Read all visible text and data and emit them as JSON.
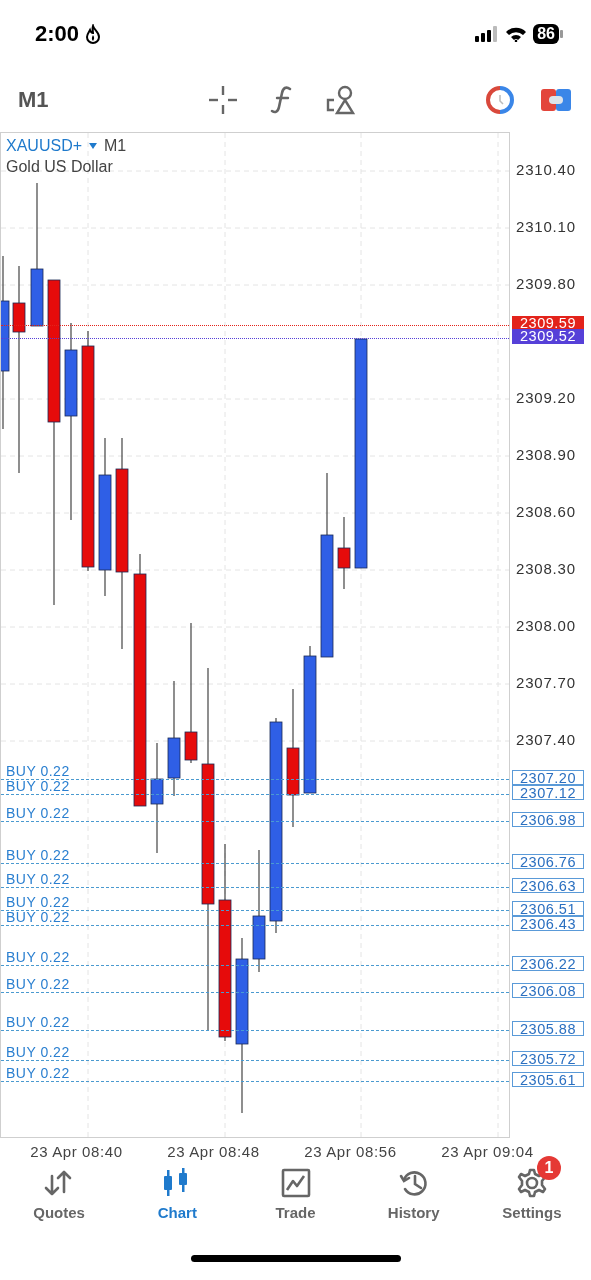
{
  "status_bar": {
    "time": "2:00",
    "battery": "86"
  },
  "toolbar": {
    "timeframe": "M1"
  },
  "chart": {
    "symbol": "XAUUSD+",
    "timeframe": "M1",
    "description": "Gold US Dollar",
    "y_ticks": [
      "2310.40",
      "2310.10",
      "2309.80",
      "2309.20",
      "2308.90",
      "2308.60",
      "2308.30",
      "2308.00",
      "2307.70",
      "2307.40"
    ],
    "price_lines": [
      {
        "price": "2309.59",
        "color": "#e3231b"
      },
      {
        "price": "2309.52",
        "color": "#5640d8"
      }
    ],
    "orders": [
      {
        "label": "BUY 0.22",
        "price": "2307.20"
      },
      {
        "label": "BUY 0.22",
        "price": "2307.12"
      },
      {
        "label": "BUY 0.22",
        "price": "2306.98"
      },
      {
        "label": "BUY 0.22",
        "price": "2306.76"
      },
      {
        "label": "BUY 0.22",
        "price": "2306.63"
      },
      {
        "label": "BUY 0.22",
        "price": "2306.51"
      },
      {
        "label": "BUY 0.22",
        "price": "2306.43"
      },
      {
        "label": "BUY 0.22",
        "price": "2306.22"
      },
      {
        "label": "BUY 0.22",
        "price": "2306.08"
      },
      {
        "label": "BUY 0.22",
        "price": "2305.88"
      },
      {
        "label": "BUY 0.22",
        "price": "2305.72"
      },
      {
        "label": "BUY 0.22",
        "price": "2305.61"
      }
    ],
    "x_ticks": [
      "23 Apr 08:40",
      "23 Apr 08:48",
      "23 Apr 08:56",
      "23 Apr 09:04"
    ]
  },
  "tabs": [
    {
      "label": "Quotes",
      "selected": false
    },
    {
      "label": "Chart",
      "selected": true
    },
    {
      "label": "Trade",
      "selected": false
    },
    {
      "label": "History",
      "selected": false
    },
    {
      "label": "Settings",
      "selected": false,
      "badge": "1"
    }
  ]
}
